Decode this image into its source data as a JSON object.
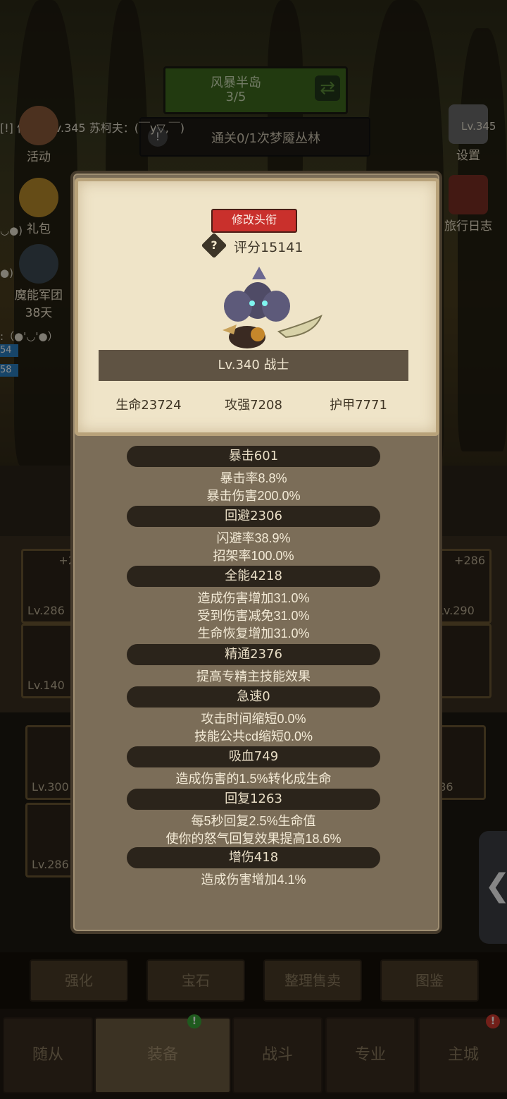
{
  "hud": {
    "zone_name": "风暴半岛",
    "zone_progress": "3/5",
    "quest": "通关0/1次梦魇丛林",
    "chat": "[!] 仿oakLv.345 苏柯夫：(￣y▽,￣)"
  },
  "side_left": [
    {
      "label": "活动"
    },
    {
      "label": "礼包"
    },
    {
      "label": "魔能军团"
    },
    {
      "label": "38天"
    }
  ],
  "side_right": [
    {
      "label": "设置",
      "badge": "Lv.345"
    },
    {
      "label": "旅行日志"
    }
  ],
  "side_notes": {
    "smile1": "◡●)",
    "smile2": "●)",
    "smile3": ":（●'◡'●）",
    "bar1": "54",
    "bar2": "58"
  },
  "equip_slots": [
    {
      "lv": "Lv.286",
      "plus": "+2"
    },
    {
      "lv": "Lv.140",
      "plus": ""
    },
    {
      "lv": "Lv.290",
      "plus": "+286"
    },
    {
      "lv": "Lv.300",
      "plus": ""
    },
    {
      "lv": "Lv.286",
      "plus": ""
    },
    {
      "lv": "286",
      "plus": ""
    }
  ],
  "popup": {
    "title_button": "修改头衔",
    "help_icon": "?",
    "score": "评分15141",
    "hero_name": "Lv.340 战士",
    "main_stats": [
      "生命23724",
      "攻强7208",
      "护甲7771"
    ],
    "groups": [
      {
        "head": "暴击601",
        "lines": [
          "暴击率8.8%",
          "暴击伤害200.0%"
        ]
      },
      {
        "head": "回避2306",
        "lines": [
          "闪避率38.9%",
          "招架率100.0%"
        ]
      },
      {
        "head": "全能4218",
        "lines": [
          "造成伤害增加31.0%",
          "受到伤害减免31.0%",
          "生命恢复增加31.0%"
        ]
      },
      {
        "head": "精通2376",
        "lines": [
          "提高专精主技能效果"
        ]
      },
      {
        "head": "急速0",
        "lines": [
          "攻击时间缩短0.0%",
          "技能公共cd缩短0.0%"
        ]
      },
      {
        "head": "吸血749",
        "lines": [
          "造成伤害的1.5%转化成生命"
        ]
      },
      {
        "head": "回复1263",
        "lines": [
          "每5秒回复2.5%生命值",
          "使你的怒气回复效果提高18.6%"
        ]
      },
      {
        "head": "增伤418",
        "lines": [
          "造成伤害增加4.1%"
        ]
      }
    ]
  },
  "actions": [
    "强化",
    "宝石",
    "整理售卖",
    "图鉴"
  ],
  "nav": [
    "随从",
    "装备",
    "战斗",
    "专业",
    "主城"
  ],
  "edge_handle": "❮",
  "colors": {
    "title_button": "#c9302c",
    "parchment": "#efe4c8",
    "panel": "#7b6d58",
    "alert_green": "#3aa537",
    "alert_red": "#d03a2e"
  }
}
